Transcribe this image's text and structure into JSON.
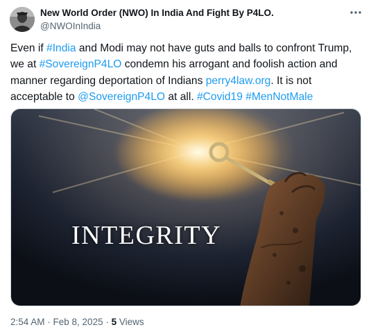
{
  "author": {
    "display_name": "New World Order (NWO) In India And Fight By P4LO.",
    "handle": "@NWOInIndia",
    "avatar_icon": "profile-avatar"
  },
  "more_icon": "more-horizontal-icon",
  "tweet": {
    "segments": [
      {
        "text": "Even if ",
        "link": false
      },
      {
        "text": "#India",
        "link": true
      },
      {
        "text": " and Modi may not have guts and balls to confront Trump, we at ",
        "link": false
      },
      {
        "text": "#SovereignP4LO",
        "link": true
      },
      {
        "text": " condemn his arrogant and foolish action and manner regarding deportation of Indians ",
        "link": false
      },
      {
        "text": "perry4law.org",
        "link": true
      },
      {
        "text": ". It is not acceptable to ",
        "link": false
      },
      {
        "text": "@SovereignP4LO",
        "link": true
      },
      {
        "text": " at all. ",
        "link": false
      },
      {
        "text": "#Covid19",
        "link": true
      },
      {
        "text": " ",
        "link": false
      },
      {
        "text": "#MenNotMale",
        "link": true
      }
    ]
  },
  "media": {
    "caption": "INTEGRITY",
    "description_icon": "key-in-hand-image"
  },
  "footer": {
    "time": "2:54 AM",
    "sep1": " · ",
    "date": "Feb 8, 2025",
    "sep2": " · ",
    "views_count": "5",
    "views_label": " Views"
  },
  "colors": {
    "link": "#1d9bf0",
    "text": "#0f1419",
    "muted": "#536471"
  }
}
